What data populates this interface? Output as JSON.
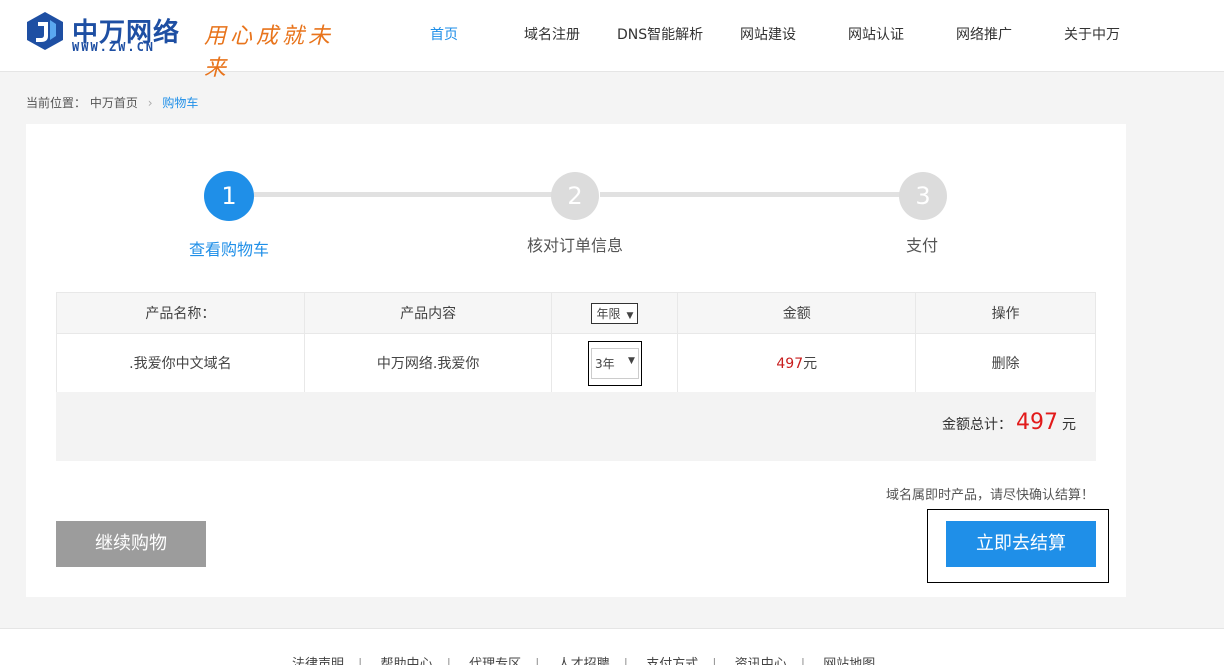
{
  "header": {
    "logo_cn": "中万网络",
    "logo_en": "WWW.ZW.CN",
    "slogan": "用心成就未来",
    "nav": [
      {
        "label": "首页",
        "active": true
      },
      {
        "label": "域名注册"
      },
      {
        "label": "DNS智能解析"
      },
      {
        "label": "网站建设"
      },
      {
        "label": "网站认证"
      },
      {
        "label": "网络推广"
      },
      {
        "label": "关于中万"
      }
    ]
  },
  "breadcrumb": {
    "prefix": "当前位置：",
    "home": "中万首页",
    "separator": "›",
    "current": "购物车"
  },
  "steps": [
    {
      "number": "1",
      "label": "查看购物车",
      "active": true
    },
    {
      "number": "2",
      "label": "核对订单信息"
    },
    {
      "number": "3",
      "label": "支付"
    }
  ],
  "table": {
    "headers": {
      "name": "产品名称：",
      "content": "产品内容",
      "period_select": "年限",
      "amount": "金额",
      "action": "操作"
    },
    "rows": [
      {
        "name": ".我爱你中文域名",
        "content": "中万网络.我爱你",
        "period": "3年",
        "amount": "497",
        "currency": "元",
        "action": "删除"
      }
    ]
  },
  "total": {
    "label": "金额总计：",
    "amount": "497",
    "unit": "元"
  },
  "notice": "域名属即时产品，请尽快确认结算！",
  "buttons": {
    "continue": "继续购物",
    "checkout": "立即去结算"
  },
  "footer": {
    "links": [
      "法律声明",
      "帮助中心",
      "代理专区",
      "人才招聘",
      "支付方式",
      "资讯中心",
      "网站地图"
    ],
    "separator": "|"
  },
  "colors": {
    "accent": "#1f8fe8",
    "price": "#c81e1e",
    "total": "#e21a1a",
    "brand": "#1e4fa3",
    "slogan": "#e8741c"
  }
}
